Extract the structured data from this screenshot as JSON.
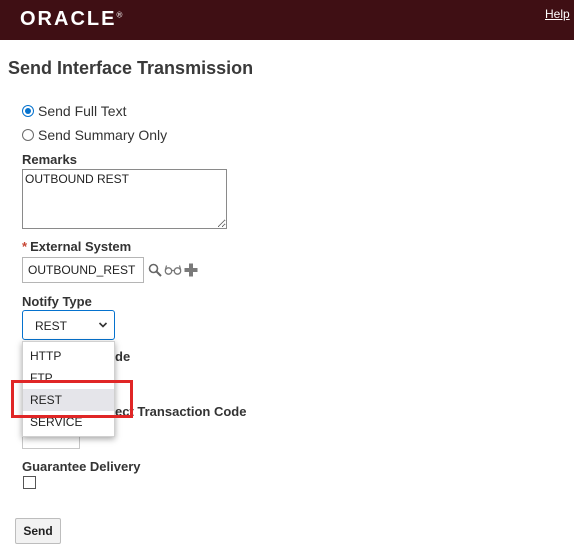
{
  "header": {
    "brand": "ORACLE",
    "trademark": "®",
    "help_link": "Help",
    "bg_color": "#3f0f14"
  },
  "page": {
    "title": "Send Interface Transmission"
  },
  "send_mode": {
    "options": [
      {
        "label": "Send Full Text",
        "selected": true
      },
      {
        "label": "Send Summary Only",
        "selected": false
      }
    ]
  },
  "remarks": {
    "label": "Remarks",
    "value": "OUTBOUND REST"
  },
  "external_system": {
    "required_mark": "*",
    "label": "External System",
    "value": "OUTBOUND_REST",
    "icons": [
      "search-icon",
      "glasses-icon",
      "add-icon"
    ]
  },
  "notify_type": {
    "label": "Notify Type",
    "selected": "REST",
    "options": [
      "HTTP",
      "FTP",
      "REST",
      "SERVICE"
    ],
    "highlighted_option": "REST",
    "accent_color": "#0572ce"
  },
  "partially_hidden": {
    "label_1_fragment": "de",
    "label_2_fragment": "ect Transaction Code"
  },
  "guarantee_delivery": {
    "label": "Guarantee Delivery",
    "checked": false
  },
  "actions": {
    "send_label": "Send"
  },
  "annotation": {
    "color": "#e02626"
  }
}
